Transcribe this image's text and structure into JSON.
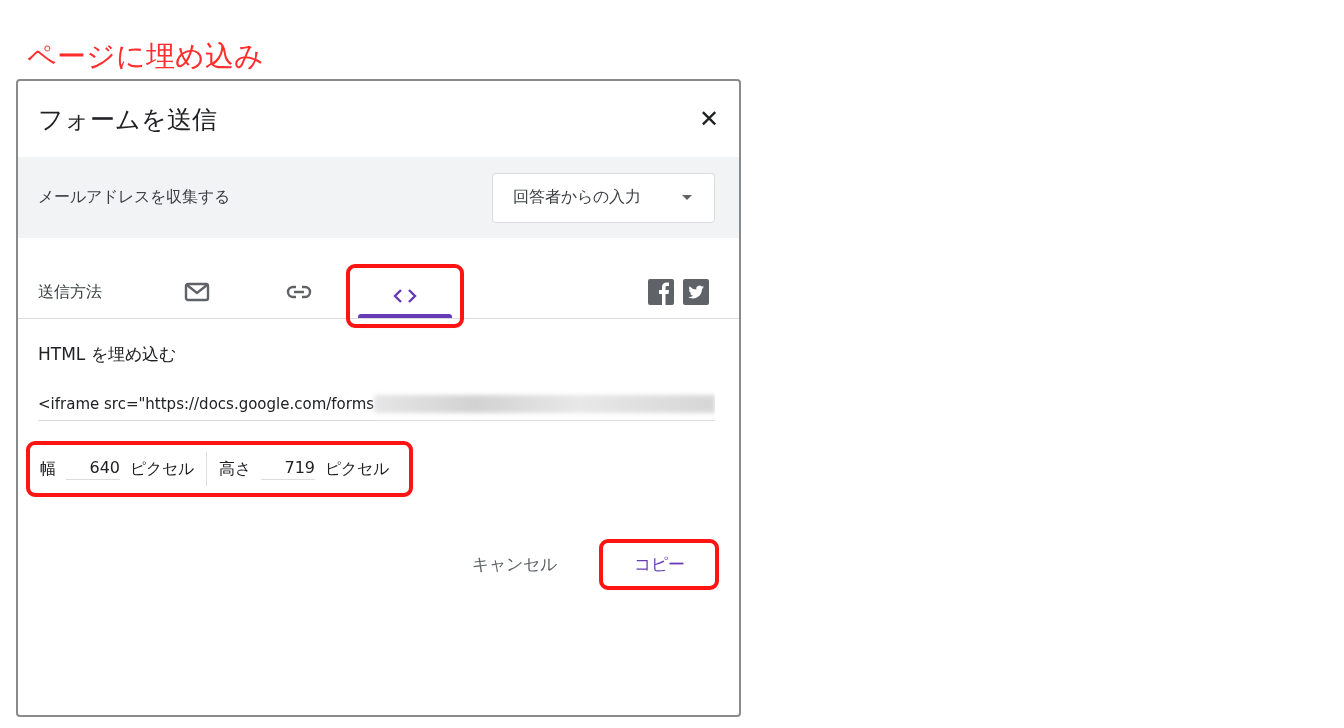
{
  "annotation": {
    "caption": "ページに埋め込み"
  },
  "dialog": {
    "title": "フォームを送信",
    "close": "✕"
  },
  "collect_email": {
    "label": "メールアドレスを収集する",
    "dropdown": {
      "value": "回答者からの入力"
    }
  },
  "send_via": {
    "label": "送信方法",
    "tabs": [
      {
        "kind": "email",
        "selected": false,
        "highlighted": false
      },
      {
        "kind": "link",
        "selected": false,
        "highlighted": false
      },
      {
        "kind": "embed",
        "selected": true,
        "highlighted": true
      }
    ],
    "share": [
      {
        "kind": "facebook"
      },
      {
        "kind": "twitter"
      }
    ]
  },
  "embed": {
    "heading": "HTML を埋め込む",
    "code": "<iframe src=\"https://docs.google.com/forms",
    "code_redacted": true,
    "size": {
      "highlighted": true,
      "fields": [
        {
          "label": "幅",
          "value": "640",
          "unit": "ピクセル"
        },
        {
          "label": "高さ",
          "value": "719",
          "unit": "ピクセル"
        }
      ]
    }
  },
  "buttons": [
    {
      "label": "キャンセル",
      "kind": "secondary",
      "highlighted": false
    },
    {
      "label": "コピー",
      "kind": "primary",
      "highlighted": true
    }
  ]
}
